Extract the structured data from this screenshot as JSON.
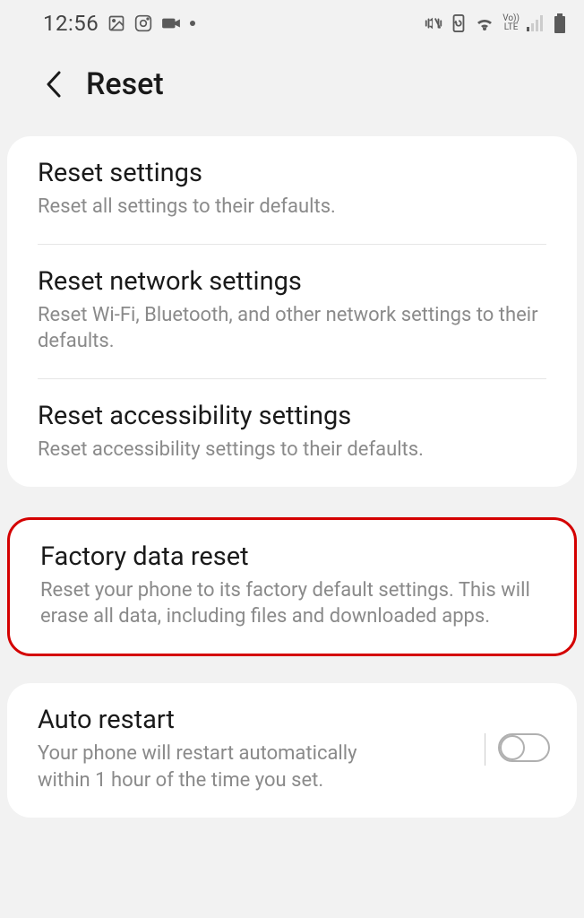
{
  "status": {
    "time": "12:56",
    "icons_left": [
      "image-icon",
      "instagram-icon",
      "camera-icon",
      "dot-icon"
    ],
    "icons_right": [
      "vibrate-icon",
      "refresh-icon",
      "wifi-icon",
      "volte-icon",
      "signal-icon",
      "battery-icon"
    ]
  },
  "header": {
    "title": "Reset"
  },
  "card1": {
    "items": [
      {
        "title": "Reset settings",
        "desc": "Reset all settings to their defaults."
      },
      {
        "title": "Reset network settings",
        "desc": "Reset Wi-Fi, Bluetooth, and other network settings to their defaults."
      },
      {
        "title": "Reset accessibility settings",
        "desc": "Reset accessibility settings to their defaults."
      }
    ]
  },
  "card2": {
    "title": "Factory data reset",
    "desc": "Reset your phone to its factory default settings. This will erase all data, including files and downloaded apps."
  },
  "card3": {
    "title": "Auto restart",
    "desc": "Your phone will restart automatically within 1 hour of the time you set.",
    "toggle": false
  }
}
